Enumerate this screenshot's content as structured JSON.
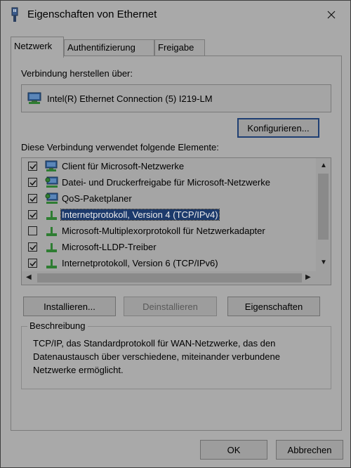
{
  "window": {
    "title": "Eigenschaften von Ethernet",
    "icon": "network-adapter-icon"
  },
  "tabs": [
    {
      "label": "Netzwerk",
      "active": true
    },
    {
      "label": "Authentifizierung",
      "active": false
    },
    {
      "label": "Freigabe",
      "active": false
    }
  ],
  "connect_via": {
    "label": "Verbindung herstellen über:",
    "adapter": "Intel(R) Ethernet Connection (5) I219-LM",
    "configure_button": "Konfigurieren..."
  },
  "items_section": {
    "label": "Diese Verbindung verwendet folgende Elemente:",
    "items": [
      {
        "label": "Client für Microsoft-Netzwerke",
        "checked": true,
        "icon": "network-client-icon",
        "selected": false
      },
      {
        "label": "Datei- und Druckerfreigabe für Microsoft-Netzwerke",
        "checked": true,
        "icon": "network-service-icon",
        "selected": false
      },
      {
        "label": "QoS-Paketplaner",
        "checked": true,
        "icon": "network-service-icon",
        "selected": false
      },
      {
        "label": "Internetprotokoll, Version 4 (TCP/IPv4)",
        "checked": true,
        "icon": "protocol-icon",
        "selected": true
      },
      {
        "label": "Microsoft-Multiplexorprotokoll für Netzwerkadapter",
        "checked": false,
        "icon": "protocol-icon",
        "selected": false
      },
      {
        "label": "Microsoft-LLDP-Treiber",
        "checked": true,
        "icon": "protocol-icon",
        "selected": false
      },
      {
        "label": "Internetprotokoll, Version 6 (TCP/IPv6)",
        "checked": true,
        "icon": "protocol-icon",
        "selected": false
      }
    ]
  },
  "actions": {
    "install": "Installieren...",
    "uninstall": "Deinstallieren",
    "properties": "Eigenschaften"
  },
  "description": {
    "legend": "Beschreibung",
    "text": "TCP/IP, das Standardprotokoll für WAN-Netzwerke, das den Datenaustausch über verschiedene, miteinander verbundene Netzwerke ermöglicht."
  },
  "footer": {
    "ok": "OK",
    "cancel": "Abbrechen"
  },
  "colors": {
    "selection": "#1c3a6c",
    "default_button_border": "#1f3f73"
  }
}
